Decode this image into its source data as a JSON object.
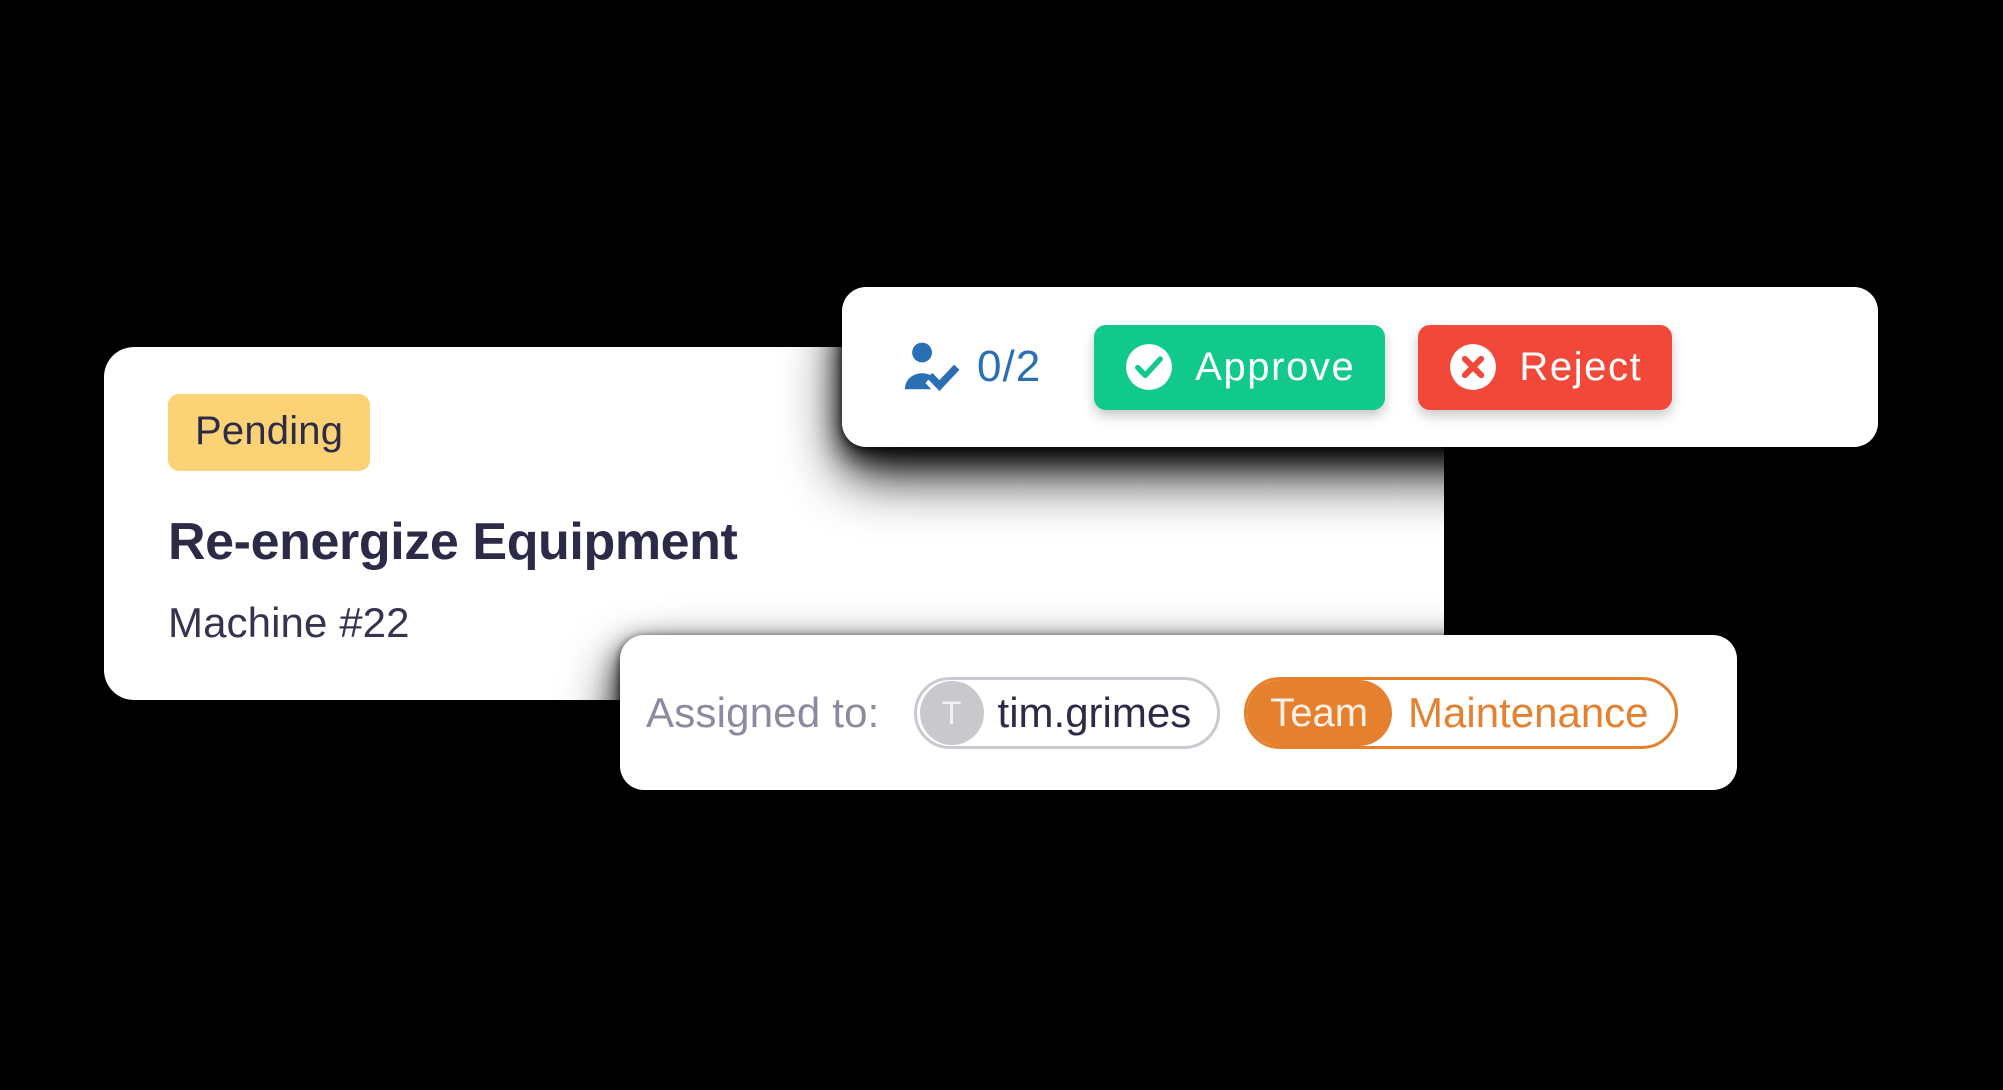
{
  "theme": {
    "background": "#000000",
    "card_surface": "#ffffff",
    "text_primary": "#2B2B47",
    "text_muted": "#8B8A9E",
    "accent_pending": "#FCD277",
    "accent_approve": "#11C98B",
    "accent_reject": "#F2483A",
    "accent_team": "#E5802F",
    "accent_blue": "#2A6FB5",
    "avatar_grey": "#C8C8CD"
  },
  "task_card": {
    "status_badge": "Pending",
    "title": "Re-energize Equipment",
    "subtitle": "Machine #22"
  },
  "approval_card": {
    "approver_icon": "person-check-icon",
    "approver_count": "0/2",
    "approve": {
      "label": "Approve",
      "icon": "check-circle-icon"
    },
    "reject": {
      "label": "Reject",
      "icon": "x-circle-icon"
    }
  },
  "assignment_card": {
    "label": "Assigned to:",
    "user": {
      "avatar_initial": "T",
      "name": "tim.grimes"
    },
    "team": {
      "kind_label": "Team",
      "name": "Maintenance"
    }
  }
}
